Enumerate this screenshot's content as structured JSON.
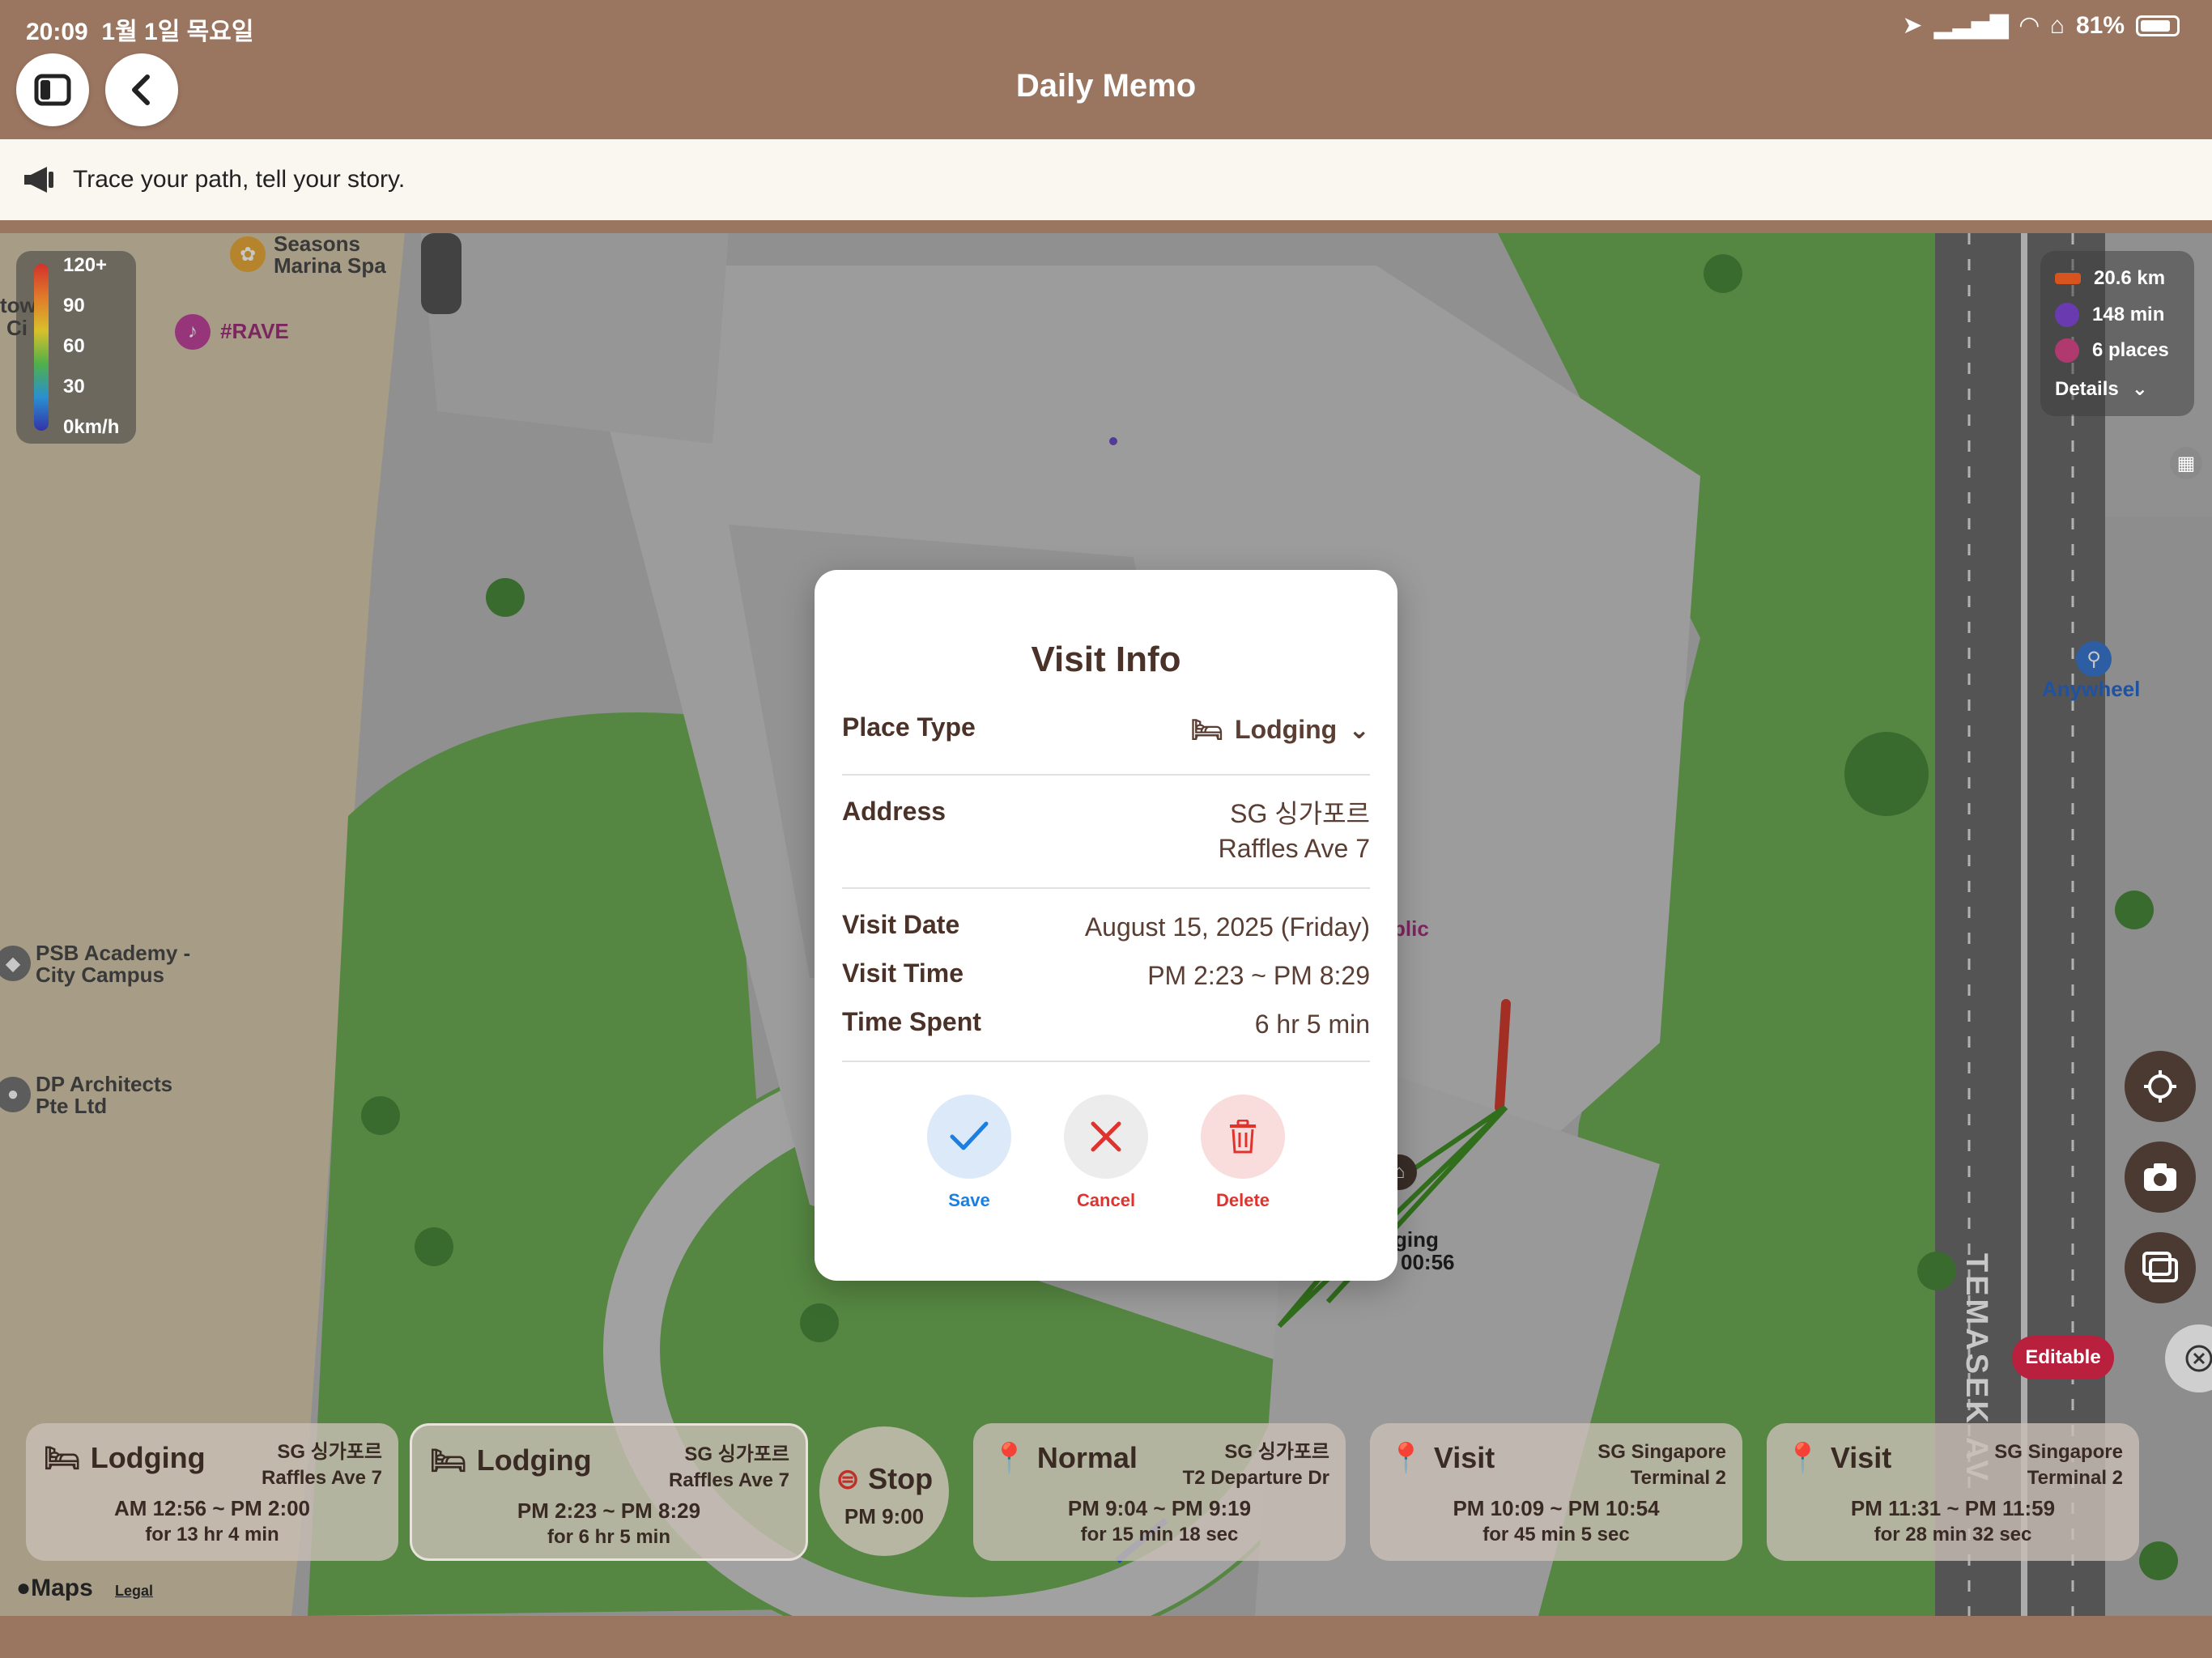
{
  "status": {
    "time": "20:09",
    "date": "1월 1일 목요일",
    "battery": "81%"
  },
  "nav": {
    "title": "Daily Memo"
  },
  "banner": {
    "text": "Trace your path, tell your story."
  },
  "speed_legend": {
    "labels": [
      "120+",
      "90",
      "60",
      "30",
      "0km/h"
    ]
  },
  "stats": {
    "distance": "20.6 km",
    "duration": "148 min",
    "places": "6 places",
    "details": "Details"
  },
  "map_labels": {
    "spa": "Seasons\nMarina Spa",
    "rave": "#RAVE",
    "psb": "PSB Academy -\nCity Campus",
    "dp": "DP Architects\nPte Ltd",
    "anywheel": "Anywheel",
    "road": "TEMASEK AV",
    "lodging_frag": "ging",
    "time_frag": "00:56",
    "plic_frag": "plic",
    "maps": "Maps",
    "legal": "Legal",
    "tow": "tow",
    "ci": "Ci"
  },
  "editable": "Editable",
  "modal": {
    "title": "Visit Info",
    "place_type_label": "Place Type",
    "place_type_value": "Lodging",
    "address_label": "Address",
    "address_line1": "SG 싱가포르",
    "address_line2": "Raffles Ave 7",
    "visit_date_label": "Visit Date",
    "visit_date_value": "August 15, 2025 (Friday)",
    "visit_time_label": "Visit Time",
    "visit_time_value": "PM 2:23 ~ PM 8:29",
    "time_spent_label": "Time Spent",
    "time_spent_value": "6 hr 5 min",
    "save": "Save",
    "cancel": "Cancel",
    "delete": "Delete"
  },
  "cards": [
    {
      "type": "Lodging",
      "addr1": "SG 싱가포르",
      "addr2": "Raffles Ave 7",
      "time": "AM 12:56 ~ PM 2:00",
      "dur": "for 13 hr 4 min"
    },
    {
      "type": "Lodging",
      "addr1": "SG 싱가포르",
      "addr2": "Raffles Ave 7",
      "time": "PM 2:23 ~ PM 8:29",
      "dur": "for 6 hr 5 min"
    },
    {
      "type": "Normal",
      "addr1": "SG 싱가포르",
      "addr2": "T2 Departure Dr",
      "time": "PM 9:04 ~ PM 9:19",
      "dur": "for 15 min 18 sec"
    },
    {
      "type": "Visit",
      "addr1": "SG Singapore",
      "addr2": "Terminal 2",
      "time": "PM 10:09 ~ PM 10:54",
      "dur": "for 45 min 5 sec"
    },
    {
      "type": "Visit",
      "addr1": "SG Singapore",
      "addr2": "Terminal 2",
      "time": "PM 11:31 ~ PM 11:59",
      "dur": "for 28 min 32 sec"
    }
  ],
  "stop": {
    "label": "Stop",
    "time": "PM 9:00"
  },
  "colors": {
    "brand_brown": "#9a7560",
    "save_blue": "#1a7fe0",
    "cancel_red": "#e0332e",
    "editable_red": "#b8203e"
  }
}
